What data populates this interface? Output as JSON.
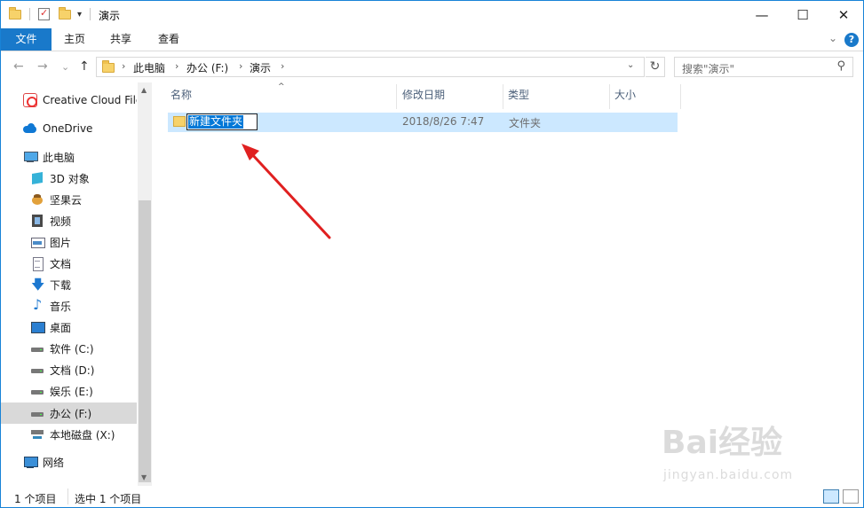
{
  "window": {
    "title": "演示",
    "controls": {
      "minimize": "—",
      "maximize": "☐",
      "close": "✕"
    }
  },
  "ribbon": {
    "tabs": [
      {
        "label": "文件",
        "active": true
      },
      {
        "label": "主页"
      },
      {
        "label": "共享"
      },
      {
        "label": "查看"
      }
    ],
    "expand_glyph": "⌄",
    "help": "?"
  },
  "navigation": {
    "back_glyph": "←",
    "forward_glyph": "→",
    "recent_glyph": "⌄",
    "up_glyph": "↑",
    "breadcrumb": [
      "此电脑",
      "办公 (F:)",
      "演示"
    ],
    "separator": "›",
    "dropdown_glyph": "⌄",
    "refresh_glyph": "↻",
    "search_placeholder": "搜索\"演示\""
  },
  "sidebar": {
    "items": [
      {
        "label": "Creative Cloud Files",
        "icon": "creative-cloud-icon"
      },
      {
        "label": "OneDrive",
        "icon": "onedrive-icon"
      },
      {
        "label": "此电脑",
        "icon": "this-pc-icon"
      },
      {
        "label": "3D 对象",
        "icon": "3d-objects-icon"
      },
      {
        "label": "坚果云",
        "icon": "jianguoyun-icon"
      },
      {
        "label": "视频",
        "icon": "videos-icon"
      },
      {
        "label": "图片",
        "icon": "pictures-icon"
      },
      {
        "label": "文档",
        "icon": "documents-icon"
      },
      {
        "label": "下载",
        "icon": "downloads-icon"
      },
      {
        "label": "音乐",
        "icon": "music-icon"
      },
      {
        "label": "桌面",
        "icon": "desktop-icon"
      },
      {
        "label": "软件 (C:)",
        "icon": "drive-icon"
      },
      {
        "label": "文档 (D:)",
        "icon": "drive-icon"
      },
      {
        "label": "娱乐 (E:)",
        "icon": "drive-icon"
      },
      {
        "label": "办公 (F:)",
        "icon": "drive-icon",
        "selected": true
      },
      {
        "label": "本地磁盘 (X:)",
        "icon": "network-drive-icon"
      },
      {
        "label": "网络",
        "icon": "network-icon"
      }
    ]
  },
  "file_list": {
    "columns": [
      "名称",
      "修改日期",
      "类型",
      "大小"
    ],
    "sort_caret": "^",
    "rows": [
      {
        "name": "新建文件夹",
        "modified": "2018/8/26 7:47",
        "type": "文件夹",
        "size": "",
        "renaming": true
      }
    ]
  },
  "status": {
    "item_count": "1 个项目",
    "selection": "选中 1 个项目"
  },
  "watermark": {
    "brand": "Bai经验",
    "url": "jingyan.baidu.com"
  },
  "colors": {
    "accent": "#1979ca",
    "selection": "#cce8ff",
    "annotation_arrow": "#e02020"
  }
}
